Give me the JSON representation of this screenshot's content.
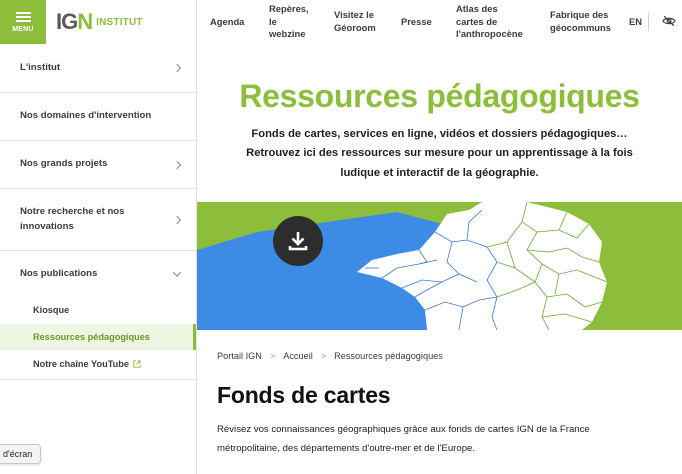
{
  "header": {
    "menu_label": "MENU",
    "logo_text_prefix": "IG",
    "logo_text_suffix": "N",
    "logo_subtitle": "INSTITUT",
    "nav": [
      {
        "label": "Agenda"
      },
      {
        "label": "Repères,\nle\nwebzine"
      },
      {
        "label": "Visitez le\nGéoroom"
      },
      {
        "label": "Presse"
      },
      {
        "label": "Atlas des\ncartes de\nl'anthropocène"
      },
      {
        "label": "Fabrique des\ngéocommuns"
      },
      {
        "label": "EN"
      }
    ],
    "accessibility_icon": "eye-slash-icon"
  },
  "sidebar": {
    "items": [
      {
        "label": "L'institut",
        "chevron": "right"
      },
      {
        "label": "Nos domaines d'intervention",
        "chevron": "none"
      },
      {
        "label": "Nos grands projets",
        "chevron": "right"
      },
      {
        "label": "Notre recherche et nos\ninnovations",
        "chevron": "right"
      },
      {
        "label": "Nos publications",
        "chevron": "down"
      }
    ],
    "sub_items": [
      {
        "label": "Kiosque",
        "active": false
      },
      {
        "label": "Ressources pédagogiques",
        "active": true
      },
      {
        "label": "Notre chaîne YouTube",
        "active": false,
        "external": true
      }
    ]
  },
  "main": {
    "title": "Ressources pédagogiques",
    "intro": "Fonds de cartes, services en ligne, vidéos et dossiers pédagogiques…\nRetrouvez ici des ressources sur mesure pour un apprentissage à la fois\nludique et interactif de la géographie.",
    "download_icon": "download-icon",
    "breadcrumb": [
      "Portail IGN",
      "Accueil",
      "Ressources pédagogiques"
    ],
    "section_title": "Fonds de cartes",
    "section_text": "Révisez vos connaissances géographiques grâce aux fonds de cartes IGN de la France métropolitaine, des départements d'outre-mer et de l'Europe."
  },
  "tooltip": "d'écran",
  "colors": {
    "accent_green": "#8cbe3c",
    "banner_blue": "#3c8ce6",
    "map_land": "#ffffff",
    "dark_button": "#2d2d2d"
  }
}
